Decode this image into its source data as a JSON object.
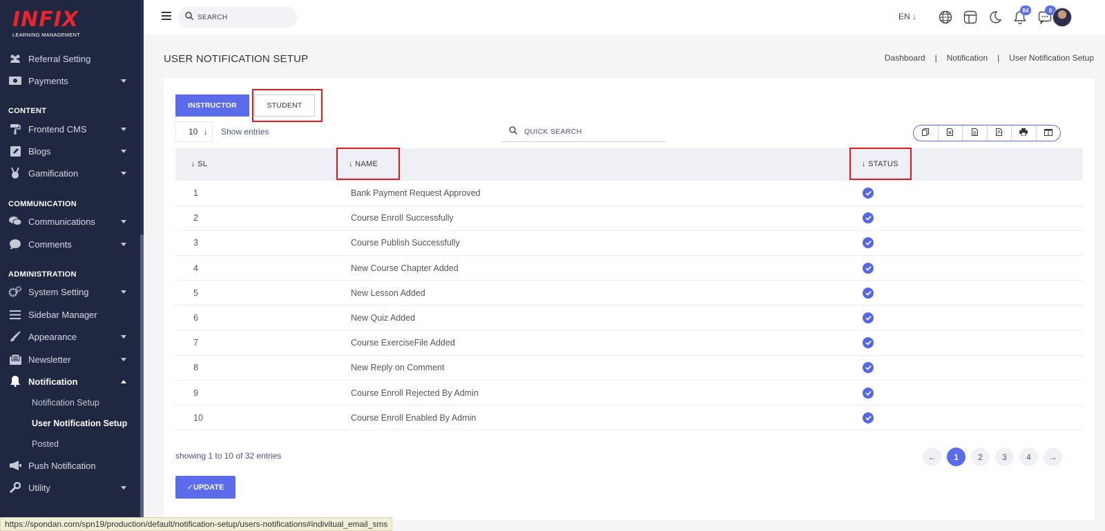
{
  "sidebar": {
    "logo": {
      "brand": "INFIX",
      "sub": "LEARNING MANAGEMENT"
    },
    "items_top": [
      {
        "label": "Referral Setting",
        "icon": "users-icon"
      },
      {
        "label": "Payments",
        "icon": "money-icon"
      }
    ],
    "sections": {
      "content": "CONTENT",
      "communication": "COMMUNICATION",
      "administration": "ADMINISTRATION"
    },
    "content_items": [
      {
        "label": "Frontend CMS",
        "icon": "paint-roller-icon"
      },
      {
        "label": "Blogs",
        "icon": "edit-icon"
      },
      {
        "label": "Gamification",
        "icon": "medal-icon"
      }
    ],
    "communication_items": [
      {
        "label": "Communications",
        "icon": "chat-icon"
      },
      {
        "label": "Comments",
        "icon": "comment-icon"
      }
    ],
    "admin_items": [
      {
        "label": "System Setting",
        "icon": "gears-icon"
      },
      {
        "label": "Sidebar Manager",
        "icon": "menu-icon"
      },
      {
        "label": "Appearance",
        "icon": "brush-icon"
      },
      {
        "label": "Newsletter",
        "icon": "newsletter-icon"
      },
      {
        "label": "Notification",
        "icon": "bell-icon"
      }
    ],
    "notification_sub": [
      "Notification Setup",
      "User Notification Setup",
      "Posted"
    ],
    "items_bottom": [
      {
        "label": "Push Notification",
        "icon": "megaphone-icon"
      },
      {
        "label": "Utility",
        "icon": "wrench-icon"
      }
    ]
  },
  "topbar": {
    "search_placeholder": "SEARCH",
    "language": "EN",
    "notifications_count": "84",
    "messages_count": "0"
  },
  "header": {
    "title": "USER NOTIFICATION SETUP",
    "breadcrumb": [
      "Dashboard",
      "Notification",
      "User Notification Setup"
    ]
  },
  "tabs": {
    "instructor": "INSTRUCTOR",
    "student": "STUDENT"
  },
  "table_controls": {
    "entries_value": "10",
    "entries_label": "Show entries",
    "quick_search": "QUICK SEARCH"
  },
  "table": {
    "headers": {
      "sl": "SL",
      "name": "NAME",
      "status": "STATUS"
    },
    "rows": [
      {
        "sl": "1",
        "name": "Bank Payment Request Approved",
        "status": true
      },
      {
        "sl": "2",
        "name": "Course Enroll Successfully",
        "status": true
      },
      {
        "sl": "3",
        "name": "Course Publish Successfully",
        "status": true
      },
      {
        "sl": "4",
        "name": "New Course Chapter Added",
        "status": true
      },
      {
        "sl": "5",
        "name": "New Lesson Added",
        "status": true
      },
      {
        "sl": "6",
        "name": "New Quiz Added",
        "status": true
      },
      {
        "sl": "7",
        "name": "Course ExerciseFile Added",
        "status": true
      },
      {
        "sl": "8",
        "name": "New Reply on Comment",
        "status": true
      },
      {
        "sl": "9",
        "name": "Course Enroll Rejected By Admin",
        "status": true
      },
      {
        "sl": "10",
        "name": "Course Enroll Enabled By Admin",
        "status": true
      }
    ]
  },
  "footer": {
    "showing": "showing 1 to 10 of 32 entries",
    "pages": [
      "1",
      "2",
      "3",
      "4"
    ],
    "active_page": "1",
    "update_label": "✓UPDATE"
  },
  "status_url": "https://spondan.com/spn19/production/default/notification-setup/users-notifications#indivitual_email_sms",
  "colors": {
    "accent": "#5b6be9",
    "sidebar_bg": "#202741",
    "highlight": "#e8141f",
    "logo_red": "#e8242f"
  }
}
